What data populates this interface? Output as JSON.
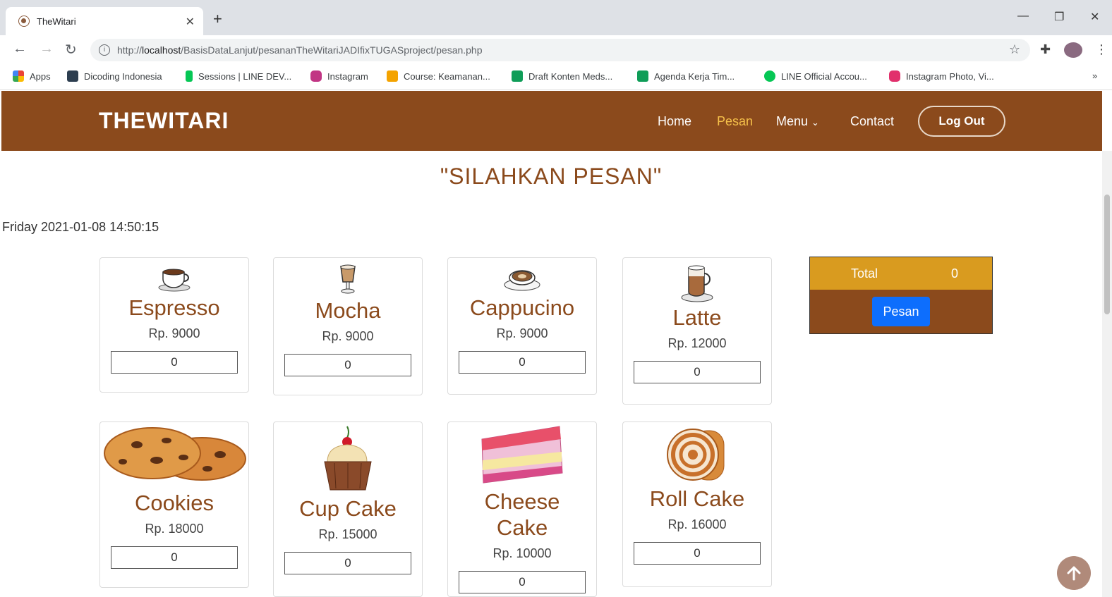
{
  "browser": {
    "tab_title": "TheWitari",
    "url_prefix": "http://",
    "url_host": "localhost",
    "url_path": "/BasisDataLanjut/pesananTheWitariJADIfixTUGASproject/pesan.php",
    "bookmarks": [
      {
        "label": "Apps",
        "color": "#ea4335"
      },
      {
        "label": "Dicoding Indonesia",
        "color": "#2d3e50"
      },
      {
        "label": "Sessions | LINE DEV...",
        "color": "#06c755"
      },
      {
        "label": "Instagram",
        "color": "#c13584"
      },
      {
        "label": "Course: Keamanan...",
        "color": "#f4a300"
      },
      {
        "label": "Draft Konten Meds...",
        "color": "#0f9d58"
      },
      {
        "label": "Agenda Kerja Tim...",
        "color": "#0f9d58"
      },
      {
        "label": "LINE Official Accou...",
        "color": "#06c755"
      },
      {
        "label": "Instagram Photo, Vi...",
        "color": "#e1306c"
      }
    ],
    "more": "»"
  },
  "site": {
    "brand": "THEWITARI",
    "nav": {
      "home": "Home",
      "pesan": "Pesan",
      "menu": "Menu",
      "contact": "Contact"
    },
    "logout": "Log Out",
    "accent": "#8b4a1c"
  },
  "page": {
    "title": "\"SILAHKAN PESAN\"",
    "datetime": "Friday 2021-01-08 14:50:15"
  },
  "items": [
    {
      "name": "Espresso",
      "price": "Rp. 9000",
      "qty": "0",
      "icon": "coffee-cup-icon"
    },
    {
      "name": "Mocha",
      "price": "Rp. 9000",
      "qty": "0",
      "icon": "mocha-glass-icon"
    },
    {
      "name": "Cappucino",
      "price": "Rp. 9000",
      "qty": "0",
      "icon": "cappucino-cup-icon"
    },
    {
      "name": "Latte",
      "price": "Rp. 12000",
      "qty": "0",
      "icon": "latte-glass-icon"
    },
    {
      "name": "Cookies",
      "price": "Rp. 18000",
      "qty": "0",
      "icon": "cookies-icon"
    },
    {
      "name": "Cup Cake",
      "price": "Rp. 15000",
      "qty": "0",
      "icon": "cupcake-icon"
    },
    {
      "name": "Cheese Cake",
      "price": "Rp. 10000",
      "qty": "0",
      "icon": "cheesecake-icon"
    },
    {
      "name": "Roll Cake",
      "price": "Rp. 16000",
      "qty": "0",
      "icon": "roll-cake-icon"
    }
  ],
  "order": {
    "total_label": "Total",
    "total_value": "0",
    "button": "Pesan"
  }
}
